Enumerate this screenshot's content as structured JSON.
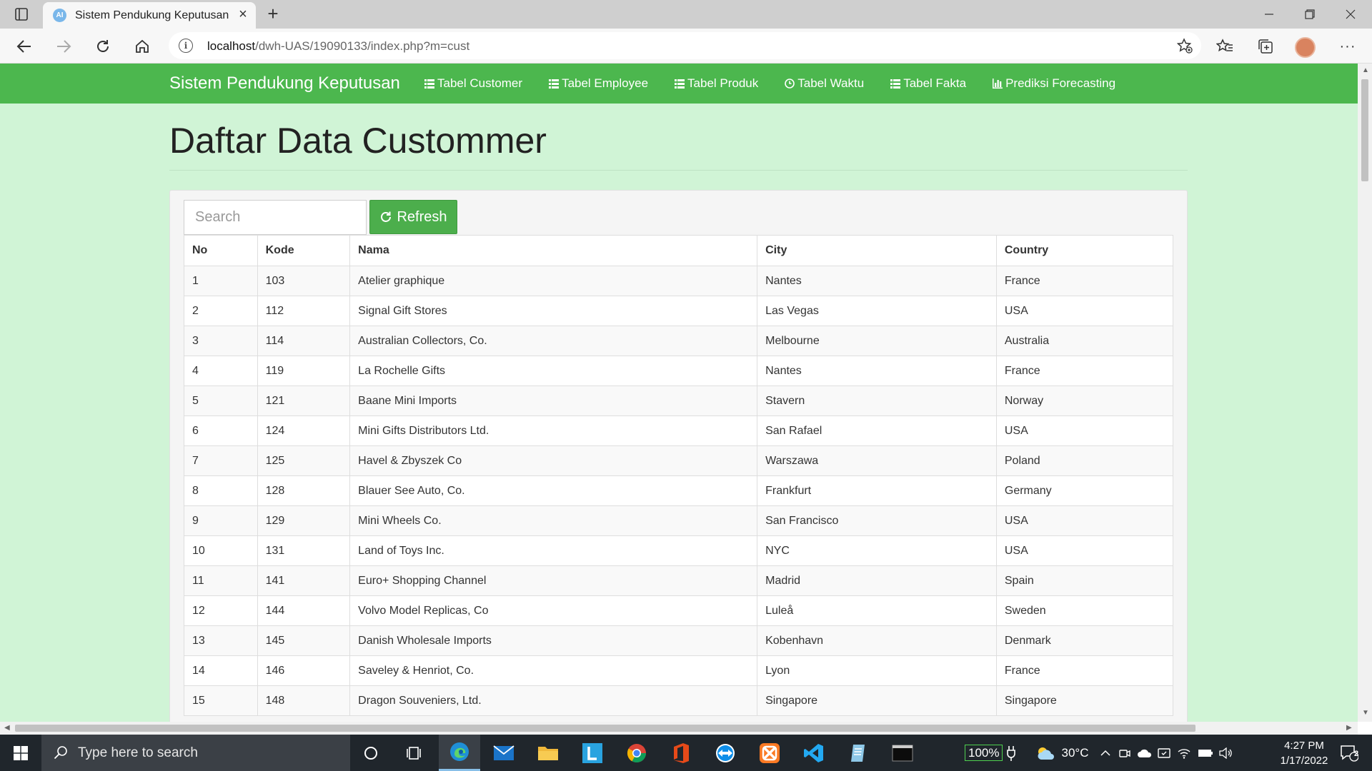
{
  "browser": {
    "tab_title": "Sistem Pendukung Keputusan",
    "favicon_text": "AI",
    "url_host": "localhost",
    "url_path": "/dwh-UAS/19090133/index.php?m=cust"
  },
  "navbar": {
    "brand": "Sistem Pendukung Keputusan",
    "links": [
      {
        "label": "Tabel Customer",
        "icon": "table-list-icon"
      },
      {
        "label": "Tabel Employee",
        "icon": "table-list-icon"
      },
      {
        "label": "Tabel Produk",
        "icon": "table-list-icon"
      },
      {
        "label": "Tabel Waktu",
        "icon": "clock-icon"
      },
      {
        "label": "Tabel Fakta",
        "icon": "table-list-icon"
      },
      {
        "label": "Prediksi Forecasting",
        "icon": "bar-chart-icon"
      }
    ]
  },
  "page": {
    "heading": "Daftar Data Custommer",
    "search_placeholder": "Search",
    "refresh_label": "Refresh"
  },
  "table": {
    "headers": [
      "No",
      "Kode",
      "Nama",
      "City",
      "Country"
    ],
    "rows": [
      [
        "1",
        "103",
        "Atelier graphique",
        "Nantes",
        "France"
      ],
      [
        "2",
        "112",
        "Signal Gift Stores",
        "Las Vegas",
        "USA"
      ],
      [
        "3",
        "114",
        "Australian Collectors, Co.",
        "Melbourne",
        "Australia"
      ],
      [
        "4",
        "119",
        "La Rochelle Gifts",
        "Nantes",
        "France"
      ],
      [
        "5",
        "121",
        "Baane Mini Imports",
        "Stavern",
        "Norway"
      ],
      [
        "6",
        "124",
        "Mini Gifts Distributors Ltd.",
        "San Rafael",
        "USA"
      ],
      [
        "7",
        "125",
        "Havel & Zbyszek Co",
        "Warszawa",
        "Poland"
      ],
      [
        "8",
        "128",
        "Blauer See Auto, Co.",
        "Frankfurt",
        "Germany"
      ],
      [
        "9",
        "129",
        "Mini Wheels Co.",
        "San Francisco",
        "USA"
      ],
      [
        "10",
        "131",
        "Land of Toys Inc.",
        "NYC",
        "USA"
      ],
      [
        "11",
        "141",
        "Euro+ Shopping Channel",
        "Madrid",
        "Spain"
      ],
      [
        "12",
        "144",
        "Volvo Model Replicas, Co",
        "Luleå",
        "Sweden"
      ],
      [
        "13",
        "145",
        "Danish Wholesale Imports",
        "Kobenhavn",
        "Denmark"
      ],
      [
        "14",
        "146",
        "Saveley & Henriot, Co.",
        "Lyon",
        "France"
      ],
      [
        "15",
        "148",
        "Dragon Souveniers, Ltd.",
        "Singapore",
        "Singapore"
      ]
    ]
  },
  "taskbar": {
    "search_placeholder": "Type here to search",
    "battery": "100%",
    "temperature": "30°C",
    "time": "4:27 PM",
    "date": "1/17/2022",
    "notifications": "2"
  },
  "colors": {
    "navbar": "#4cb74e",
    "page_background": "#d0f4d6",
    "button": "#4cae4c"
  }
}
